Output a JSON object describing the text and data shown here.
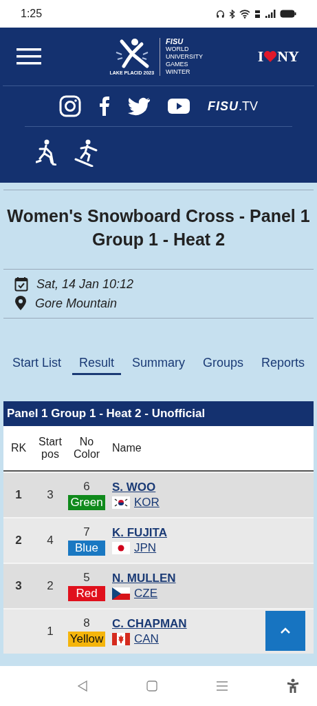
{
  "status_bar": {
    "time": "1:25"
  },
  "header": {
    "logo": {
      "caption": "LAKE PLACID 2023",
      "brand": "FISU",
      "lines": [
        "WORLD",
        "UNIVERSITY",
        "GAMES",
        "WINTER"
      ]
    },
    "partner": {
      "left": "I",
      "right": "NY"
    },
    "fisu_tv": {
      "brand": "FISU",
      "suffix": ".TV"
    }
  },
  "event": {
    "title": "Women's Snowboard Cross - Panel 1 Group 1 - Heat 2",
    "date": "Sat, 14 Jan 10:12",
    "venue": "Gore Mountain"
  },
  "tabs": [
    {
      "label": "Start List",
      "selected": false
    },
    {
      "label": "Result",
      "selected": true
    },
    {
      "label": "Summary",
      "selected": false
    },
    {
      "label": "Groups",
      "selected": false
    },
    {
      "label": "Reports",
      "selected": false
    }
  ],
  "table": {
    "title": "Panel 1 Group 1 - Heat 2  -  Unofficial",
    "columns": [
      "RK",
      "Start pos",
      "No Color",
      "Name"
    ],
    "rows": [
      {
        "rank": "1",
        "start": "3",
        "no": "6",
        "bib": {
          "label": "Green",
          "color": "#108a1c"
        },
        "name": "S. WOO",
        "kind": "korea",
        "country": "KOR"
      },
      {
        "rank": "2",
        "start": "4",
        "no": "7",
        "bib": {
          "label": "Blue",
          "color": "#1a78c2"
        },
        "name": "K. FUJITA",
        "kind": "japan",
        "country": "JPN"
      },
      {
        "rank": "3",
        "start": "2",
        "no": "5",
        "bib": {
          "label": "Red",
          "color": "#e0101c"
        },
        "name": "N. MULLEN",
        "kind": "czechia",
        "country": "CZE"
      },
      {
        "start": "1",
        "no": "8",
        "bib": {
          "label": "Yellow",
          "color": "#f5b50c"
        },
        "name": "C. CHAPMAN",
        "kind": "canada",
        "country": "CAN"
      }
    ]
  }
}
